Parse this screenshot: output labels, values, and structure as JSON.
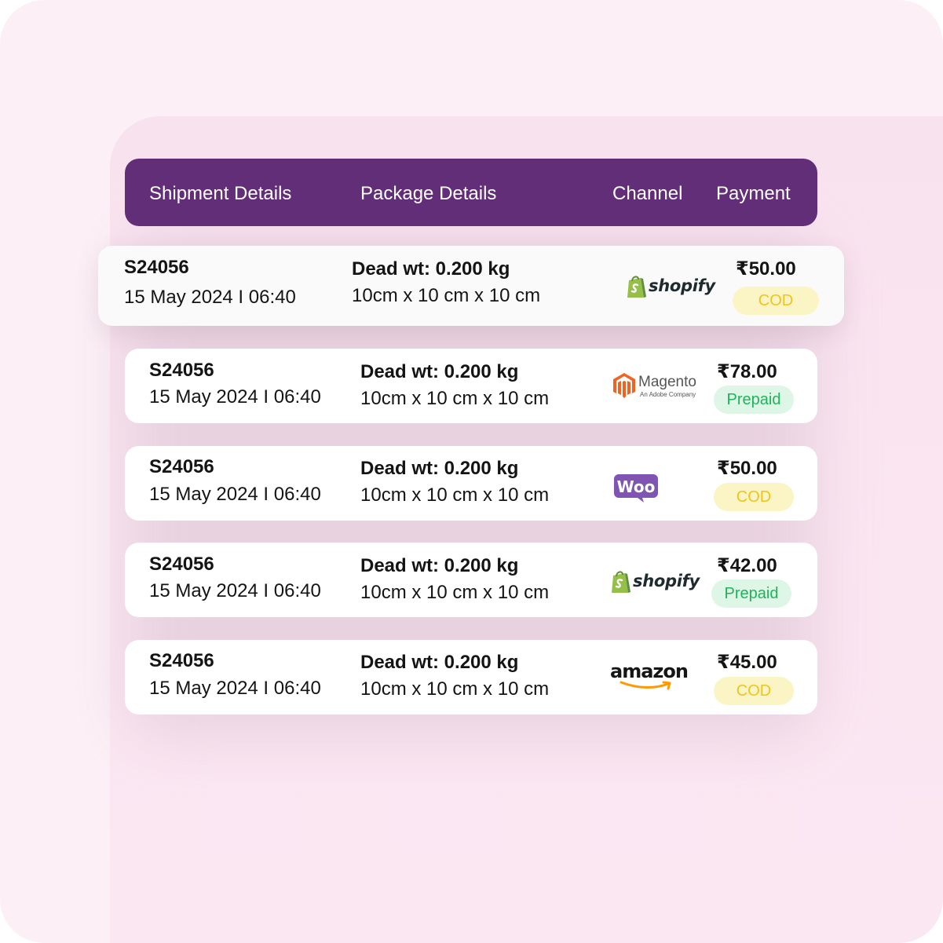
{
  "header": {
    "shipment_details": "Shipment Details",
    "package_details": "Package Details",
    "channel": "Channel",
    "payment": "Payment"
  },
  "colors": {
    "header_bg": "#622e78",
    "cod_bg": "#fbf5c6",
    "cod_text": "#f2c318",
    "prepaid_bg": "#ddf6e5",
    "prepaid_text": "#1fb35b",
    "page_bg": "#fcf0f6"
  },
  "rows": [
    {
      "shipment_id": "S24056",
      "date": "15 May 2024 I 06:40",
      "weight": "Dead wt: 0.200 kg",
      "dimensions": "10cm x 10 cm x 10 cm",
      "channel": "shopify",
      "channel_icon": "shopify-logo-icon",
      "price": "₹50.00",
      "payment_status": "COD"
    },
    {
      "shipment_id": "S24056",
      "date": "15 May 2024 I 06:40",
      "weight": "Dead wt: 0.200 kg",
      "dimensions": "10cm x 10 cm x 10 cm",
      "channel": "Magento",
      "channel_subtitle": "An Adobe Company",
      "channel_icon": "magento-logo-icon",
      "price": "₹78.00",
      "payment_status": "Prepaid"
    },
    {
      "shipment_id": "S24056",
      "date": "15 May 2024 I 06:40",
      "weight": "Dead wt: 0.200 kg",
      "dimensions": "10cm x 10 cm x 10 cm",
      "channel": "Woo",
      "channel_icon": "woocommerce-logo-icon",
      "price": "₹50.00",
      "payment_status": "COD"
    },
    {
      "shipment_id": "S24056",
      "date": "15 May 2024 I 06:40",
      "weight": "Dead wt: 0.200 kg",
      "dimensions": "10cm x 10 cm x 10 cm",
      "channel": "shopify",
      "channel_icon": "shopify-logo-icon",
      "price": "₹42.00",
      "payment_status": "Prepaid"
    },
    {
      "shipment_id": "S24056",
      "date": "15 May 2024 I 06:40",
      "weight": "Dead wt: 0.200 kg",
      "dimensions": "10cm x 10 cm x 10 cm",
      "channel": "amazon",
      "channel_icon": "amazon-logo-icon",
      "price": "₹45.00",
      "payment_status": "COD"
    }
  ]
}
